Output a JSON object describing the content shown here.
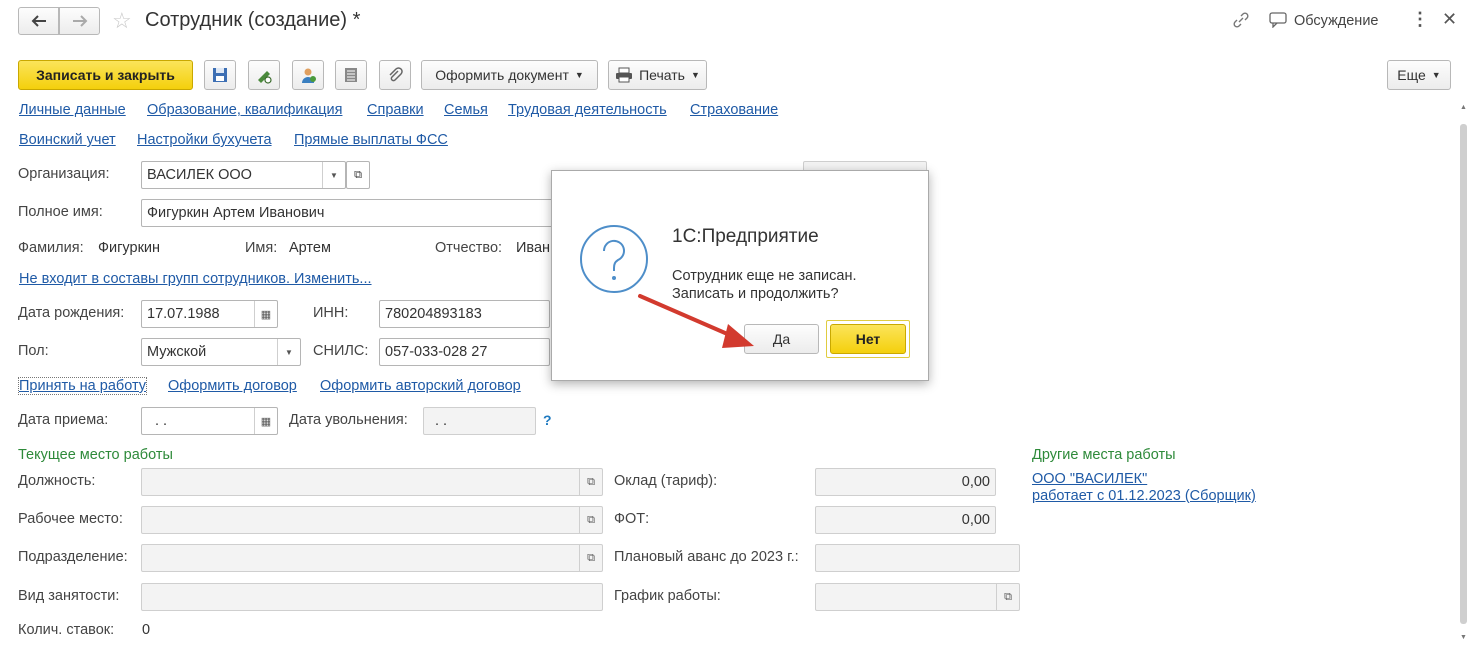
{
  "window": {
    "title": "Сотрудник (создание) *",
    "discussion_label": "Обсуждение"
  },
  "toolbar": {
    "save_close": "Записать и закрыть",
    "issue_doc": "Оформить документ",
    "print": "Печать",
    "more": "Еще"
  },
  "links_row1": [
    "Личные данные",
    "Образование, квалификация",
    "Справки",
    "Семья",
    "Трудовая деятельность",
    "Страхование"
  ],
  "links_row2": [
    "Воинский учет",
    "Настройки бухучета",
    "Прямые выплаты ФСС"
  ],
  "form": {
    "org_label": "Организация:",
    "org_value": "ВАСИЛЕК ООО",
    "fullname_label": "Полное имя:",
    "fullname_value": "Фигуркин Артем Иванович",
    "lastname_label": "Фамилия:",
    "lastname_value": "Фигуркин",
    "firstname_label": "Имя:",
    "firstname_value": "Артем",
    "patronymic_label": "Отчество:",
    "patronymic_value": "Иван",
    "groups_link": "Не входит в составы групп сотрудников. Изменить...",
    "birth_label": "Дата рождения:",
    "birth_value": "17.07.1988",
    "inn_label": "ИНН:",
    "inn_value": "780204893183",
    "sex_label": "Пол:",
    "sex_value": "Мужской",
    "snils_label": "СНИЛС:",
    "snils_value": "057-033-028 27",
    "hire_link": "Принять на работу",
    "contract_link": "Оформить договор",
    "author_contract_link": "Оформить авторский договор",
    "hire_date_label": "Дата приема:",
    "hire_date_value": " .  .",
    "fire_date_label": "Дата увольнения:",
    "fire_date_value": " .  .",
    "help": "?",
    "current_place": "Текущее место работы",
    "position_label": "Должность:",
    "workplace_label": "Рабочее место:",
    "department_label": "Подразделение:",
    "employment_label": "Вид занятости:",
    "rates_label": "Колич. ставок:",
    "rates_value": "0",
    "salary_label": "Оклад (тариф):",
    "salary_value": "0,00",
    "fot_label": "ФОТ:",
    "fot_value": "0,00",
    "advance_label": "Плановый аванс до 2023 г.:",
    "schedule_label": "График работы:",
    "other_places": "Другие места работы",
    "other_place_link1": "ООО \"ВАСИЛЕК\"",
    "other_place_link2": "работает с 01.12.2023 (Сборщик)"
  },
  "dialog": {
    "title": "1С:Предприятие",
    "message1": "Сотрудник еще не записан.",
    "message2": "Записать и продолжить?",
    "yes": "Да",
    "no": "Нет"
  }
}
